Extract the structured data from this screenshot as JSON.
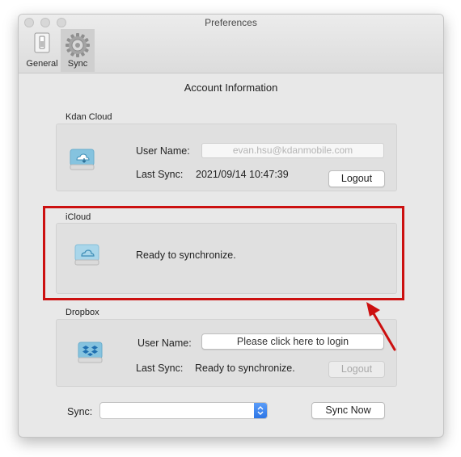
{
  "window": {
    "title": "Preferences"
  },
  "toolbar": {
    "tabs": [
      {
        "label": "General",
        "icon": "switch-icon"
      },
      {
        "label": "Sync",
        "icon": "gear-icon",
        "selected": true
      }
    ]
  },
  "main": {
    "title": "Account Information",
    "kdan": {
      "label": "Kdan Cloud",
      "user_label": "User Name:",
      "user_value": "evan.hsu@kdanmobile.com",
      "last_sync_label": "Last Sync:",
      "last_sync_value": "2021/09/14 10:47:39",
      "logout_label": "Logout"
    },
    "icloud": {
      "label": "iCloud",
      "status": "Ready to synchronize."
    },
    "dropbox": {
      "label": "Dropbox",
      "user_label": "User Name:",
      "login_label": "Please click here to login",
      "last_sync_label": "Last Sync:",
      "last_sync_value": "Ready to synchronize.",
      "logout_label": "Logout"
    },
    "sync": {
      "label": "Sync:",
      "selected_value": "",
      "sync_now_label": "Sync Now"
    }
  },
  "colors": {
    "highlight": "#cc1010",
    "accent": "#2d76e6"
  }
}
